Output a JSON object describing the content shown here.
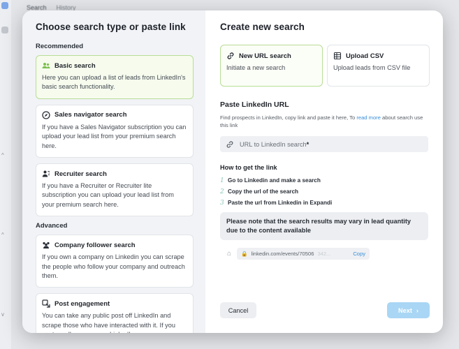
{
  "background": {
    "tabs": [
      "Search",
      "History"
    ]
  },
  "left": {
    "title": "Choose search type or paste link",
    "recommended_label": "Recommended",
    "advanced_label": "Advanced",
    "recommended": [
      {
        "title": "Basic search",
        "desc": "Here you can upload a list of leads from LinkedIn's basic search functionality.",
        "icon": "people-icon"
      },
      {
        "title": "Sales navigator search",
        "desc": "If you have a Sales Navigator subscription you can upload your lead list from your premium search here.",
        "icon": "compass-icon"
      },
      {
        "title": "Recruiter search",
        "desc": "If you have a Recruiter or Recruiter lite subscription you can upload your lead list from your premium search here.",
        "icon": "recruiter-icon"
      }
    ],
    "advanced": [
      {
        "title": "Company follower search",
        "desc": "If you own a company on Linkedin you can scrape the people who follow your company and outreach them.",
        "icon": "company-icon"
      },
      {
        "title": "Post engagement",
        "desc": "You can take any public post off LinkedIn and scrape those who have interacted with it. If you post a poll on your own LinkedIn you are",
        "icon": "post-icon"
      }
    ]
  },
  "right": {
    "title": "Create new search",
    "modes": [
      {
        "title": "New URL search",
        "desc": "Initiate a new search",
        "icon": "link-icon"
      },
      {
        "title": "Upload CSV",
        "desc": "Upload leads from CSV file",
        "icon": "table-icon"
      }
    ],
    "paste_title": "Paste LinkedIn URL",
    "help_before": "Find prospects in LinkedIn, copy link and paste it here, To ",
    "help_link": "read more",
    "help_after": " about search use this link",
    "input_placeholder": "URL to LinkedIn search",
    "input_required": "*",
    "howto_title": "How to get the link",
    "steps": [
      {
        "num": "1",
        "text": "Go to Linkedin and make a search"
      },
      {
        "num": "2",
        "text": "Copy the url of the search"
      },
      {
        "num": "3",
        "text": "Paste the url from Linkedin in Expandi"
      }
    ],
    "note": "Please note that the search results may vary in lead quantity due to the content available",
    "browser_url": "linkedin.com/events/70506",
    "browser_url_fade": "342...",
    "copy_label": "Copy",
    "cancel_label": "Cancel",
    "next_label": "Next"
  },
  "colors": {
    "selected_border": "#b8dd95",
    "selected_bg": "#f6fbee",
    "next_button": "#a9d6f4",
    "link": "#3a8fd8",
    "step_number": "#8cc7b8"
  }
}
